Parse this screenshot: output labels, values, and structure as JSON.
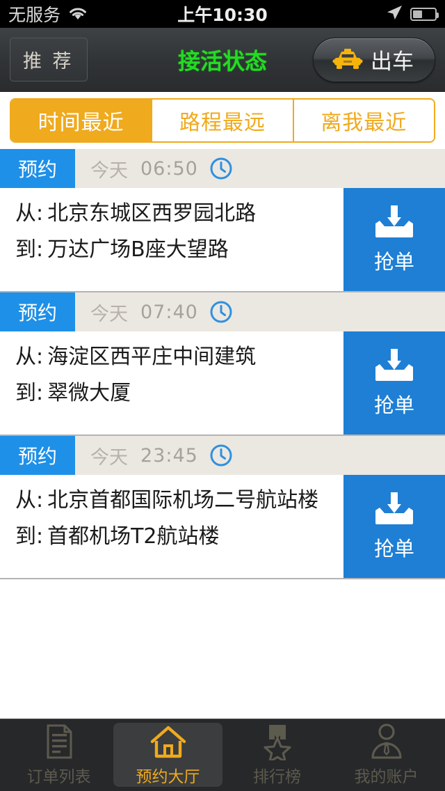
{
  "statusbar": {
    "carrier": "无服务",
    "wifi_icon": "wifi-icon",
    "time": "上午10:30",
    "location_icon": "location-arrow-icon",
    "battery_icon": "battery-icon",
    "battery_level_pct": 42
  },
  "navbar": {
    "left_button": "推 荐",
    "title": "接活状态",
    "title_color": "#22dd22",
    "dispatch_button": "出车",
    "taxi_icon": "taxi-icon",
    "taxi_icon_color": "#f5b30c"
  },
  "segmented": {
    "accent_color": "#efaa1e",
    "active_index": 0,
    "items": [
      {
        "label": "时间最近",
        "active": true
      },
      {
        "label": "路程最远",
        "active": false
      },
      {
        "label": "离我最近",
        "active": false
      }
    ]
  },
  "orders": {
    "badge_color": "#1e90e8",
    "grab_color": "#1e7fd4",
    "from_label": "从:",
    "to_label": "到:",
    "grab_label": "抢单",
    "grab_icon": "download-tray-icon",
    "clock_icon": "clock-icon",
    "items": [
      {
        "badge": "预约",
        "day": "今天",
        "time": "06:50",
        "from": "北京东城区西罗园北路",
        "to": "万达广场B座大望路"
      },
      {
        "badge": "预约",
        "day": "今天",
        "time": "07:40",
        "from": "海淀区西平庄中间建筑",
        "to": "翠微大厦"
      },
      {
        "badge": "预约",
        "day": "今天",
        "time": "23:45",
        "from": "北京首都国际机场二号航站楼",
        "to": "首都机场T2航站楼"
      }
    ]
  },
  "tabbar": {
    "active_index": 1,
    "active_color": "#efaa1e",
    "items": [
      {
        "label": "订单列表",
        "icon": "document-icon",
        "active": false
      },
      {
        "label": "预约大厅",
        "icon": "home-icon",
        "active": true
      },
      {
        "label": "排行榜",
        "icon": "medal-star-icon",
        "active": false
      },
      {
        "label": "我的账户",
        "icon": "person-tie-icon",
        "active": false
      }
    ]
  }
}
